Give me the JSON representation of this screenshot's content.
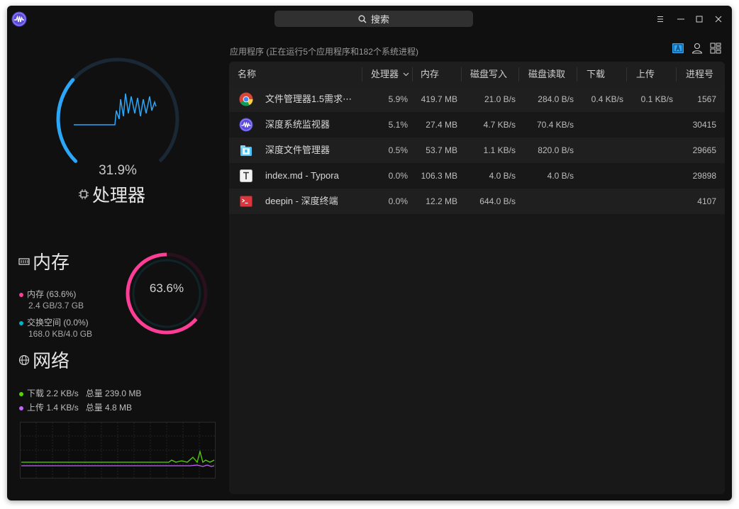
{
  "titlebar": {
    "search_label": "搜索"
  },
  "cpu": {
    "percent": "31.9%",
    "title": "处理器",
    "usage_fraction": 0.319
  },
  "memory": {
    "title": "内存",
    "gauge_value": "63.6%",
    "usage_fraction": 0.636,
    "mem_label": "内存 (63.6%)",
    "mem_detail": "2.4 GB/3.7 GB",
    "swap_label": "交换空间 (0.0%)",
    "swap_detail": "168.0 KB/4.0 GB"
  },
  "network": {
    "title": "网络",
    "download": "下载 2.2 KB/s",
    "download_total": "总量 239.0 MB",
    "upload": "上传 1.4 KB/s",
    "upload_total": "总量 4.8 MB"
  },
  "summary": "应用程序 (正在运行5个应用程序和182个系统进程)",
  "table": {
    "headers": [
      "名称",
      "处理器",
      "内存",
      "磁盘写入",
      "磁盘读取",
      "下载",
      "上传",
      "进程号"
    ],
    "rows": [
      {
        "icon": "chrome-icon",
        "name": "文件管理器1.5需求⋯",
        "cpu": "5.9%",
        "mem": "419.7 MB",
        "dw": "21.0 B/s",
        "dr": "284.0 B/s",
        "down": "0.4 KB/s",
        "up": "0.1 KB/s",
        "pid": "1567"
      },
      {
        "icon": "system-monitor-icon",
        "name": "深度系统监视器",
        "cpu": "5.1%",
        "mem": "27.4 MB",
        "dw": "4.7 KB/s",
        "dr": "70.4 KB/s",
        "down": "",
        "up": "",
        "pid": "30415"
      },
      {
        "icon": "file-manager-icon",
        "name": "深度文件管理器",
        "cpu": "0.5%",
        "mem": "53.7 MB",
        "dw": "1.1 KB/s",
        "dr": "820.0 B/s",
        "down": "",
        "up": "",
        "pid": "29665"
      },
      {
        "icon": "typora-icon",
        "name": "index.md - Typora",
        "cpu": "0.0%",
        "mem": "106.3 MB",
        "dw": "4.0 B/s",
        "dr": "4.0 B/s",
        "down": "",
        "up": "",
        "pid": "29898"
      },
      {
        "icon": "terminal-icon",
        "name": "deepin - 深度终端",
        "cpu": "0.0%",
        "mem": "12.2 MB",
        "dw": "644.0 B/s",
        "dr": "",
        "down": "",
        "up": "",
        "pid": "4107"
      }
    ]
  },
  "colors": {
    "cpu": "#2ca7f8",
    "memory": "#fd3e96",
    "swap": "#00b4c8",
    "download": "#55d500",
    "upload": "#c362ff"
  }
}
